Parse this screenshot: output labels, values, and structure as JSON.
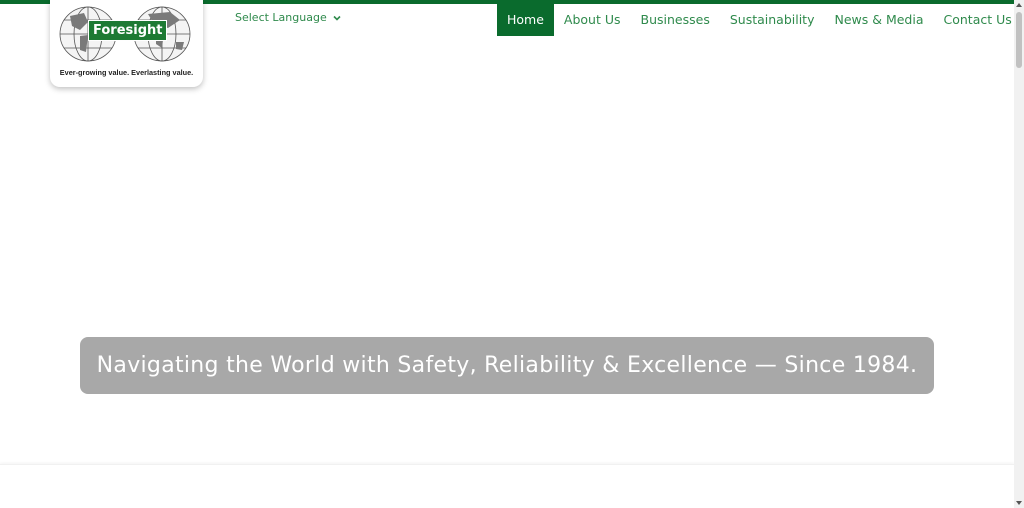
{
  "logo": {
    "name": "Foresight",
    "tagline": "Ever-growing value. Everlasting value.",
    "icon": "world-map-globe-icon"
  },
  "language": {
    "label": "Select Language",
    "icon": "chevron-down-icon"
  },
  "nav": {
    "items": [
      {
        "label": "Home",
        "active": true
      },
      {
        "label": "About Us"
      },
      {
        "label": "Businesses"
      },
      {
        "label": "Sustainability"
      },
      {
        "label": "News & Media"
      },
      {
        "label": "Contact Us"
      }
    ]
  },
  "hero": {
    "headline": "Navigating the World with Safety, Reliability & Excellence — Since 1984."
  },
  "colors": {
    "brand_green": "#0a6b2d",
    "link_green": "#2f8a4c",
    "banner_gray": "#a8a8a8"
  }
}
